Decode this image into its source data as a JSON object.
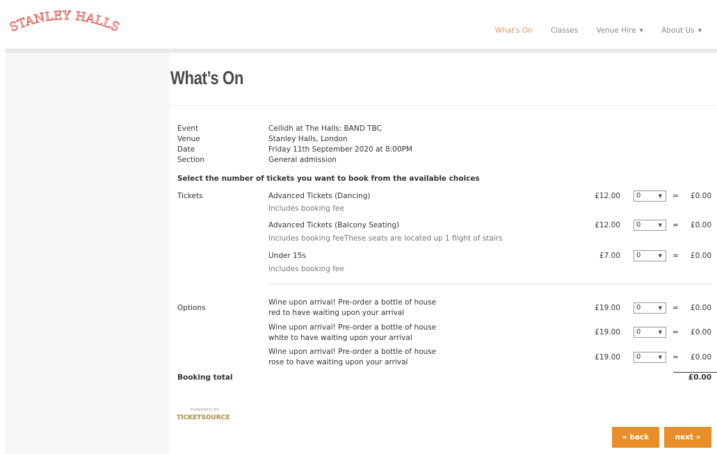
{
  "header": {
    "logo_text": "STANLEY HALLS",
    "nav": [
      {
        "label": "What's On",
        "active": true
      },
      {
        "label": "Classes",
        "active": false
      },
      {
        "label": "Venue Hire",
        "active": false
      },
      {
        "label": "About Us",
        "active": false
      }
    ],
    "caret": "▼"
  },
  "page": {
    "title": "What’s On"
  },
  "event": {
    "labels": {
      "event": "Event",
      "venue": "Venue",
      "date": "Date",
      "section": "Section"
    },
    "values": {
      "event": "Ceilidh at The Halls: BAND TBC",
      "venue": "Stanley Halls, London",
      "date": "Friday 11th September 2020 at 8:00PM",
      "section": "General admission"
    }
  },
  "instructions": "Select the number of tickets you want to book from the available choices",
  "tickets": {
    "label": "Tickets",
    "items": [
      {
        "name": "Advanced Tickets (Dancing)",
        "note": "Includes booking fee",
        "price": "£12.00",
        "qty": "0",
        "amount": "£0.00"
      },
      {
        "name": "Advanced Tickets (Balcony Seating)",
        "note": "Includes booking feeThese seats are located up 1 flight of stairs",
        "price": "£12.00",
        "qty": "0",
        "amount": "£0.00"
      },
      {
        "name": "Under 15s",
        "note": "Includes booking fee",
        "price": "£7.00",
        "qty": "0",
        "amount": "£0.00"
      }
    ]
  },
  "options": {
    "label": "Options",
    "items": [
      {
        "line1": "Wine upon arrival! Pre-order a bottle of house",
        "line2": "red to have waiting upon your arrival",
        "price": "£19.00",
        "qty": "0",
        "amount": "£0.00"
      },
      {
        "line1": "Wine upon arrival! Pre-order a bottle of house",
        "line2": "white to have waiting upon your arrival",
        "price": "£19.00",
        "qty": "0",
        "amount": "£0.00"
      },
      {
        "line1": "Wine upon arrival! Pre-order a bottle of house",
        "line2": "rose to have waiting upon your arrival",
        "price": "£19.00",
        "qty": "0",
        "amount": "£0.00"
      }
    ]
  },
  "equals": "=",
  "select_arrow": "▼",
  "total": {
    "label": "Booking total",
    "amount": "£0.00"
  },
  "powered_by": {
    "line1": "POWERED BY",
    "line2": "TICKETSOURCE"
  },
  "buttons": {
    "back": "« back",
    "next": "next »"
  },
  "colors": {
    "accent": "#e88f2a",
    "nav_active": "#e9955a",
    "logo_red": "#d9453c"
  }
}
